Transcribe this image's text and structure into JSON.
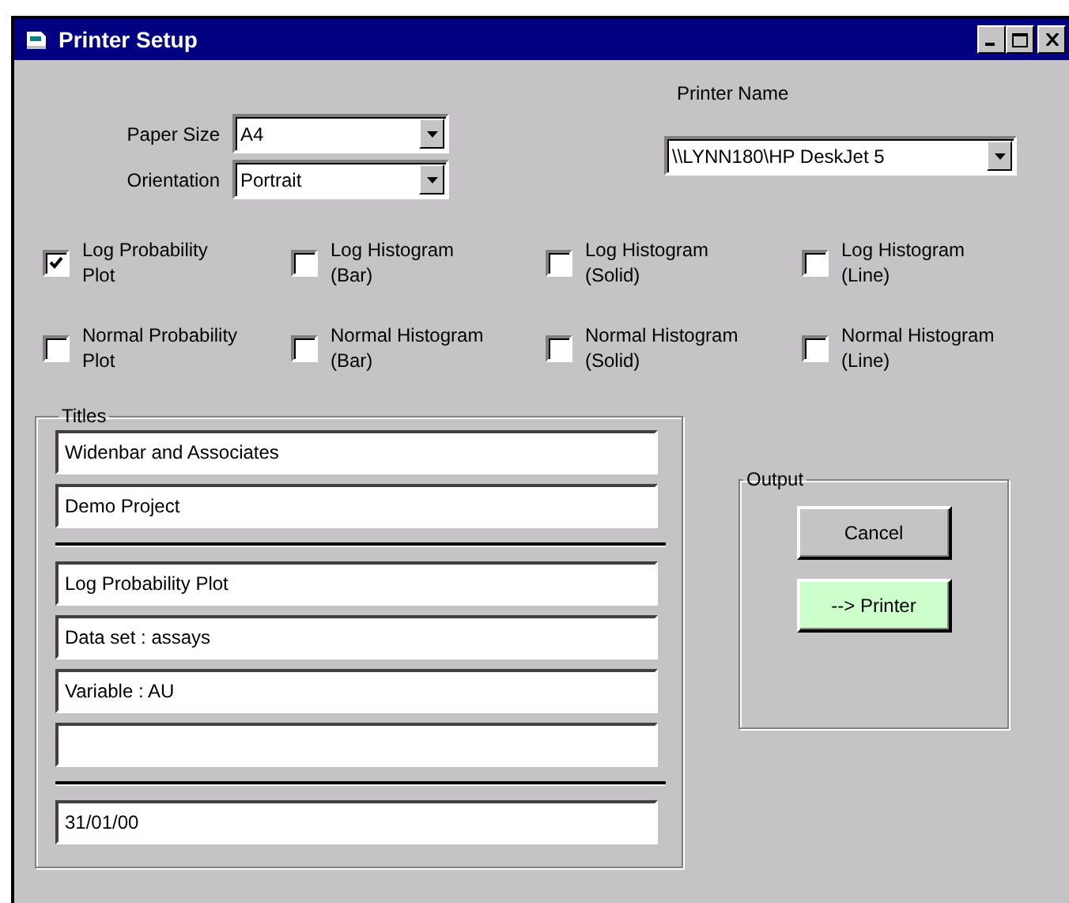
{
  "window": {
    "title": "Printer Setup"
  },
  "paper_size": {
    "label": "Paper Size",
    "value": "A4"
  },
  "orientation": {
    "label": "Orientation",
    "value": "Portrait"
  },
  "printer": {
    "label": "Printer Name",
    "value": "\\\\LYNN180\\HP DeskJet 5"
  },
  "plots": [
    {
      "label": "Log Probability Plot",
      "checked": true
    },
    {
      "label": "Log Histogram (Bar)",
      "checked": false
    },
    {
      "label": "Log Histogram (Solid)",
      "checked": false
    },
    {
      "label": "Log Histogram (Line)",
      "checked": false
    },
    {
      "label": "Normal Probability Plot",
      "checked": false
    },
    {
      "label": "Normal Histogram (Bar)",
      "checked": false
    },
    {
      "label": "Normal Histogram (Solid)",
      "checked": false
    },
    {
      "label": "Normal Histogram (Line)",
      "checked": false
    }
  ],
  "titles": {
    "label": "Titles",
    "groups": [
      [
        {
          "value": "Widenbar and Associates"
        },
        {
          "value": "Demo Project"
        }
      ],
      [
        {
          "value": "Log Probability Plot"
        },
        {
          "value": "Data set : assays"
        },
        {
          "value": "Variable : AU"
        },
        {
          "kind": "blank"
        }
      ],
      [
        {
          "value": "31/01/00"
        }
      ]
    ]
  },
  "output": {
    "label": "Output",
    "buttons": [
      {
        "label": "Cancel",
        "kind": "plain"
      },
      {
        "label": "--> Printer",
        "kind": "accent"
      }
    ]
  }
}
